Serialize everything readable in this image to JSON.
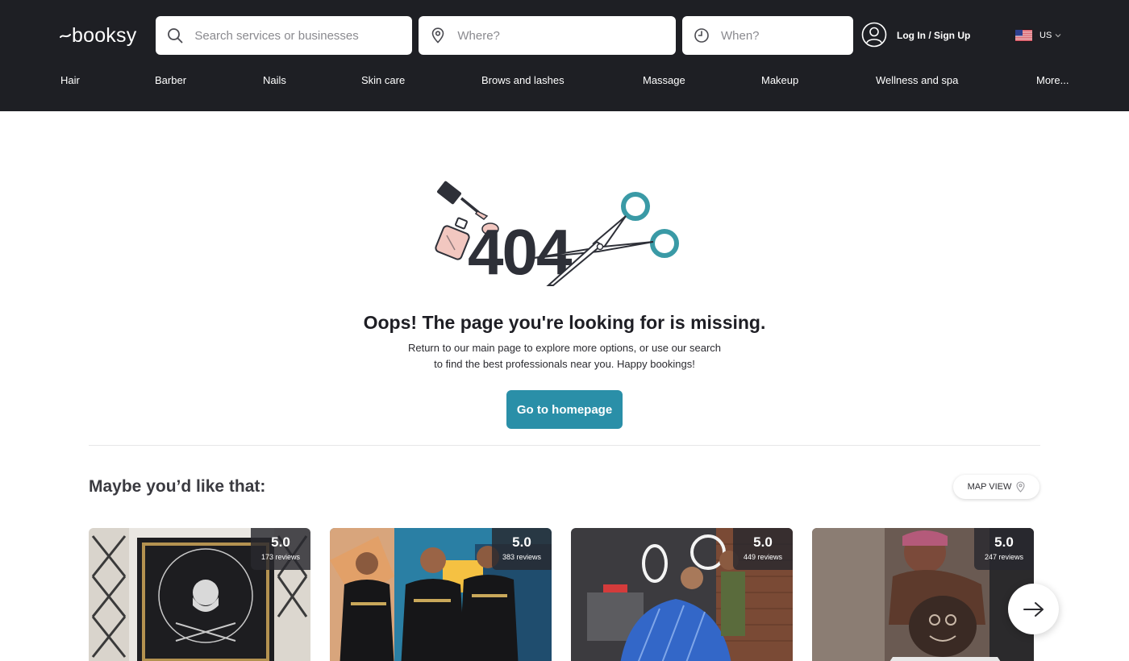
{
  "header": {
    "logo_text": "booksy",
    "search": {
      "placeholder": "Search services or businesses"
    },
    "where": {
      "placeholder": "Where?"
    },
    "when": {
      "placeholder": "When?"
    },
    "login_label": "Log In / Sign Up",
    "locale_label": "US"
  },
  "categories": [
    "Hair",
    "Barber",
    "Nails",
    "Skin care",
    "Brows and lashes",
    "Massage",
    "Makeup",
    "Wellness and spa",
    "More..."
  ],
  "error": {
    "code": "404",
    "title": "Oops! The page you're looking for is missing.",
    "desc_line1": "Return to our main page to explore more options, or use our search",
    "desc_line2": "to find the best professionals near you. Happy bookings!",
    "button_label": "Go to homepage"
  },
  "recommendations": {
    "title": "Maybe you’d like that:",
    "map_view_label": "MAP VIEW",
    "cards": [
      {
        "score": "5.0",
        "reviews": "173 reviews",
        "image": "salon-logo-sign-renee-z-edge"
      },
      {
        "score": "5.0",
        "reviews": "383 reviews",
        "image": "three-barbers-team-photo"
      },
      {
        "score": "5.0",
        "reviews": "449 reviews",
        "image": "barber-chair-ring-lights"
      },
      {
        "score": "5.0",
        "reviews": "247 reviews",
        "image": "barber-cutting-hair-design"
      }
    ]
  },
  "icons": {
    "search": "search-icon",
    "where": "location-pin-icon",
    "when": "clock-icon",
    "user": "user-avatar-icon",
    "flag": "us-flag-icon",
    "next": "arrow-right-icon"
  },
  "colors": {
    "header_bg": "#1e1f24",
    "primary": "#2a8fa8",
    "text_dark": "#1e1e24",
    "scissors_accent": "#3a9aa6",
    "bottle_accent": "#f2c7c0"
  }
}
